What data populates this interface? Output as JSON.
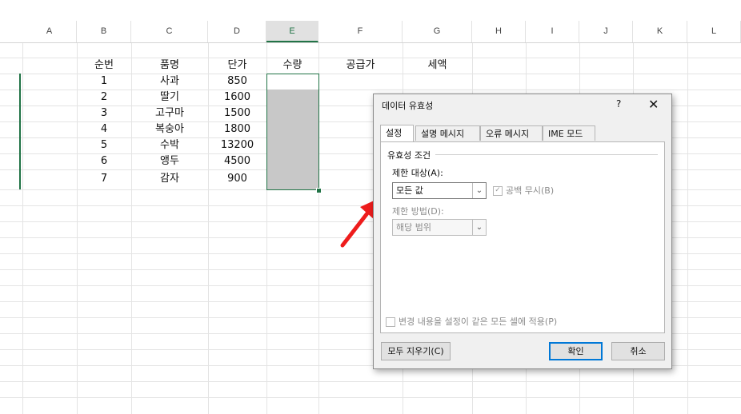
{
  "columns": [
    "A",
    "B",
    "C",
    "D",
    "E",
    "F",
    "G",
    "H",
    "I",
    "J",
    "K",
    "L"
  ],
  "selected_column": "E",
  "sheet": {
    "headers": {
      "no": "순번",
      "item": "품명",
      "price": "단가",
      "qty": "수량",
      "supply": "공급가",
      "tax": "세액"
    },
    "rows": [
      {
        "no": "1",
        "item": "사과",
        "price": "850"
      },
      {
        "no": "2",
        "item": "딸기",
        "price": "1600"
      },
      {
        "no": "3",
        "item": "고구마",
        "price": "1500"
      },
      {
        "no": "4",
        "item": "복숭아",
        "price": "1800"
      },
      {
        "no": "5",
        "item": "수박",
        "price": "13200"
      },
      {
        "no": "6",
        "item": "앵두",
        "price": "4500"
      },
      {
        "no": "7",
        "item": "감자",
        "price": "900"
      }
    ]
  },
  "dialog": {
    "title": "데이터 유효성",
    "help": "?",
    "close": "✕",
    "tabs": [
      "설정",
      "설명 메시지",
      "오류 메시지",
      "IME 모드"
    ],
    "group_label": "유효성 조건",
    "allow_label": "제한 대상(A):",
    "allow_value": "모든 값",
    "ignore_blank": "공백 무시(B)",
    "data_label": "제한 방법(D):",
    "data_value": "해당 범위",
    "apply_all": "변경 내용을 설정이 같은 모든 셀에 적용(P)",
    "clear_all": "모두 지우기(C)",
    "ok": "확인",
    "cancel": "취소",
    "dropdown_glyph": "⌄",
    "check_glyph": "✓"
  },
  "colors": {
    "accent": "#217346",
    "arrow": "#ee1c1c",
    "dialog_bg": "#f0f0f0",
    "primary_border": "#0078d7"
  }
}
